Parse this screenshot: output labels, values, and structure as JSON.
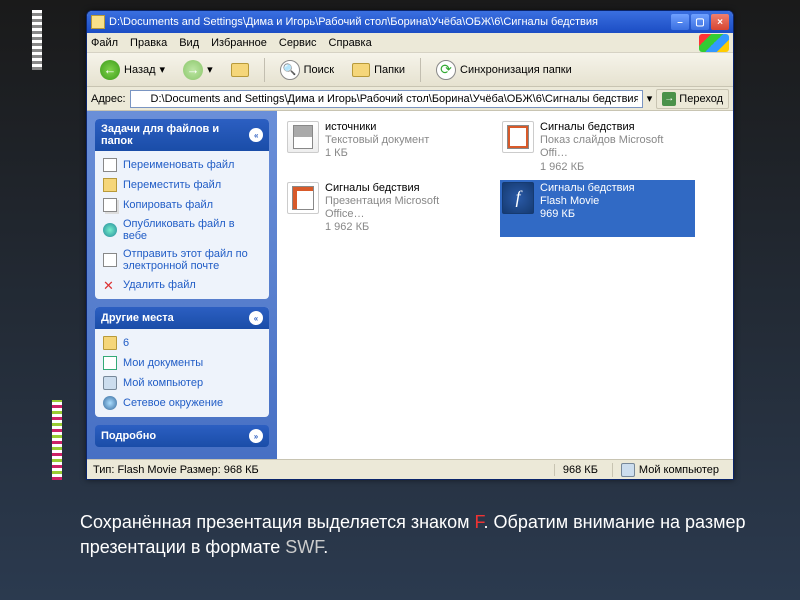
{
  "titlebar": {
    "title": "D:\\Documents and Settings\\Дима и Игорь\\Рабочий стол\\Борина\\Учёба\\ОБЖ\\6\\Сигналы бедствия"
  },
  "menubar": {
    "file": "Файл",
    "edit": "Правка",
    "view": "Вид",
    "favorites": "Избранное",
    "tools": "Сервис",
    "help": "Справка"
  },
  "toolbar": {
    "back": "Назад",
    "search": "Поиск",
    "folders": "Папки",
    "sync": "Синхронизация папки"
  },
  "addressbar": {
    "label": "Адрес:",
    "value": "D:\\Documents and Settings\\Дима и Игорь\\Рабочий стол\\Борина\\Учёба\\ОБЖ\\6\\Сигналы бедствия",
    "go": "Переход"
  },
  "side": {
    "tasks": {
      "title": "Задачи для файлов и папок",
      "rename": "Переименовать файл",
      "move": "Переместить файл",
      "copy": "Копировать файл",
      "publish": "Опубликовать файл в вебе",
      "email": "Отправить этот файл по электронной почте",
      "delete": "Удалить файл"
    },
    "places": {
      "title": "Другие места",
      "p6": "6",
      "mydocs": "Мои документы",
      "mycomp": "Мой компьютер",
      "net": "Сетевое окружение"
    },
    "details": {
      "title": "Подробно"
    }
  },
  "files": [
    {
      "name": "источники",
      "type": "Текстовый документ",
      "size": "1 КБ",
      "icon": "txt",
      "selected": false
    },
    {
      "name": "Сигналы бедствия",
      "type": "Показ слайдов Microsoft Offi…",
      "size": "1 962 КБ",
      "icon": "pps",
      "selected": false
    },
    {
      "name": "Сигналы бедствия",
      "type": "Презентация Microsoft Office…",
      "size": "1 962 КБ",
      "icon": "ppt",
      "selected": false
    },
    {
      "name": "Сигналы бедствия",
      "type": "Flash Movie",
      "size": "969 КБ",
      "icon": "swf",
      "selected": true
    }
  ],
  "statusbar": {
    "info": "Тип: Flash Movie Размер: 968 КБ",
    "size": "968 КБ",
    "location": "Мой компьютер"
  },
  "caption": {
    "t1": "Сохранённая презентация выделяется знаком ",
    "f": "F",
    "t2": ". Обратим внимание на размер презентации в формате ",
    "swf": "SWF",
    "t3": "."
  }
}
